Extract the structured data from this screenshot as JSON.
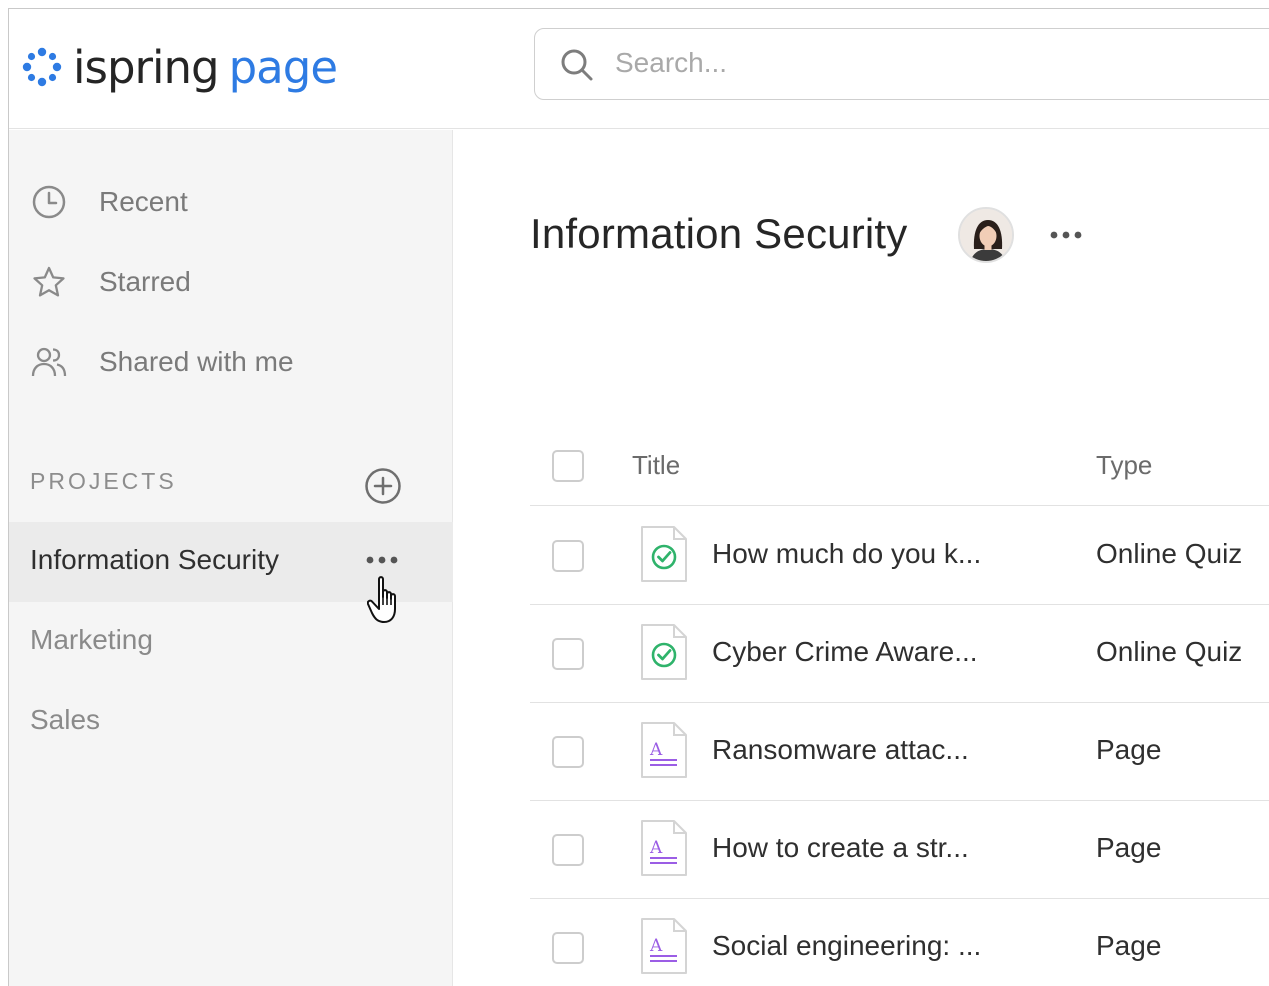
{
  "header": {
    "logo_word1": "ispring",
    "logo_word2": "page",
    "search_placeholder": "Search..."
  },
  "sidebar": {
    "nav": [
      {
        "label": "Recent",
        "icon": "clock-icon"
      },
      {
        "label": "Starred",
        "icon": "star-icon"
      },
      {
        "label": "Shared with me",
        "icon": "users-icon"
      }
    ],
    "projects_heading": "PROJECTS",
    "projects": [
      {
        "label": "Information Security",
        "active": true
      },
      {
        "label": "Marketing",
        "active": false
      },
      {
        "label": "Sales",
        "active": false
      }
    ]
  },
  "main": {
    "title": "Information Security",
    "table": {
      "columns": [
        "Title",
        "Type"
      ],
      "rows": [
        {
          "name": "How much do you k...",
          "type": "Online Quiz",
          "icon": "quiz-icon"
        },
        {
          "name": "Cyber Crime Aware...",
          "type": "Online Quiz",
          "icon": "quiz-icon"
        },
        {
          "name": "Ransomware attac...",
          "type": "Page",
          "icon": "page-icon"
        },
        {
          "name": "How to create a str...",
          "type": "Page",
          "icon": "page-icon"
        },
        {
          "name": "Social engineering: ...",
          "type": "Page",
          "icon": "page-icon"
        }
      ]
    }
  },
  "colors": {
    "brand_blue": "#2e7be3",
    "quiz_green": "#2fb36b",
    "page_purple": "#9b5de5",
    "sidebar_bg": "#f5f5f5"
  }
}
